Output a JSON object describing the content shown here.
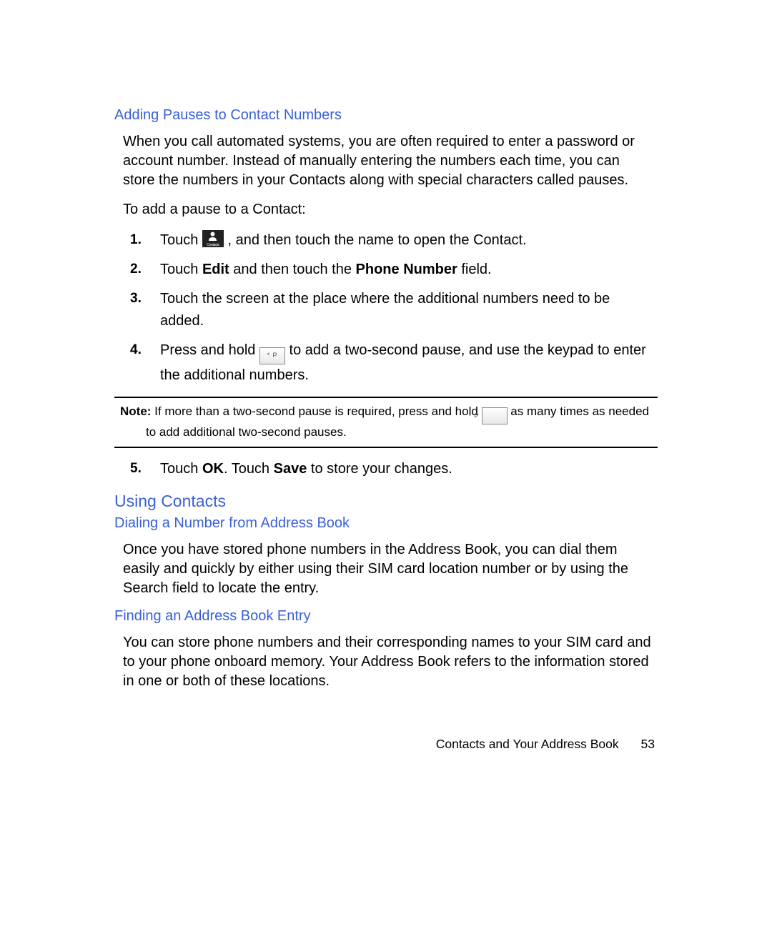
{
  "section1": {
    "heading": "Adding Pauses to Contact Numbers",
    "para1": "When you call automated systems, you are often required to enter a password or account number. Instead of manually entering the numbers each time, you can store the numbers in your Contacts along with special characters called pauses.",
    "para2": "To add a pause to a Contact:",
    "steps": {
      "s1a": "Touch ",
      "s1b": " , and then touch the name to open the Contact.",
      "s2a": "Touch ",
      "s2b": "Edit",
      "s2c": " and then touch the ",
      "s2d": "Phone Number",
      "s2e": " field.",
      "s3": "Touch the screen at the place where the additional numbers need to be added.",
      "s4a": "Press and hold ",
      "s4b": " to add a two-second pause, and use the keypad to enter the additional numbers.",
      "s5a": "Touch ",
      "s5b": "OK",
      "s5c": ". Touch ",
      "s5d": "Save",
      "s5e": " to store your changes."
    },
    "contacts_icon_label": "Contacts"
  },
  "note": {
    "label": "Note: ",
    "text1": "If more than a two-second pause is required, press and hold ",
    "text2": " as many times as needed to add additional two-second pauses."
  },
  "section2": {
    "heading": "Using Contacts",
    "sub1": {
      "heading": "Dialing a Number from Address Book",
      "para": "Once you have stored phone numbers in the Address Book, you can dial them easily and quickly by either using their SIM card location number or by using the Search field to locate the entry."
    },
    "sub2": {
      "heading": "Finding an Address Book Entry",
      "para": "You can store phone numbers and their corresponding names to your SIM card and to your phone onboard memory. Your Address Book refers to the information stored in one or both of these locations."
    }
  },
  "footer": {
    "chapter": "Contacts and Your Address Book",
    "page": "53"
  },
  "pause_key_label": "* P"
}
